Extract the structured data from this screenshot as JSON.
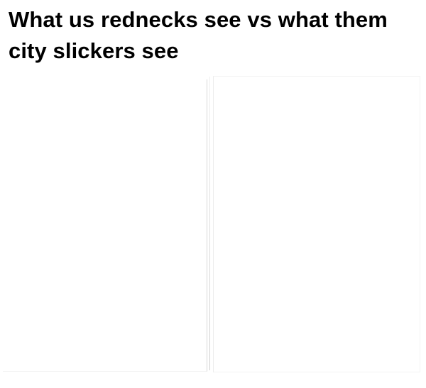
{
  "caption": {
    "text": "What us rednecks see vs what them city slickers see"
  }
}
